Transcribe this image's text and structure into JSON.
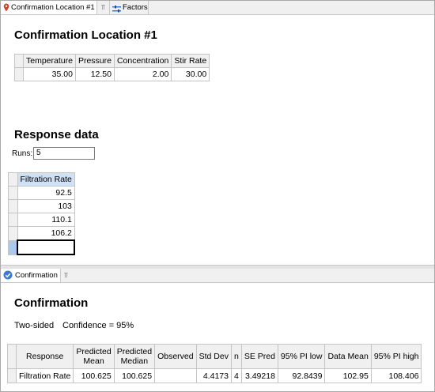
{
  "tabs_top": {
    "tab1": {
      "label": "Confirmation Location #1",
      "icon": "location-pin-icon"
    },
    "pin_glyph": "⫪",
    "tab2": {
      "label": "Factors",
      "icon": "factors-icon"
    }
  },
  "location": {
    "title": "Confirmation Location #1",
    "factor_headers": [
      "Temperature",
      "Pressure",
      "Concentration",
      "Stir Rate"
    ],
    "factor_values": [
      "35.00",
      "12.50",
      "2.00",
      "30.00"
    ]
  },
  "response": {
    "title": "Response data",
    "runs_label": "Runs:",
    "runs_value": "5",
    "column_header": "Filtration Rate",
    "values": [
      "92.5",
      "103",
      "110.1",
      "106.2",
      ""
    ]
  },
  "tabs_bottom": {
    "tab1": {
      "label": "Confirmation",
      "icon": "check-circle-icon"
    },
    "pin_glyph": "⫪"
  },
  "confirmation": {
    "title": "Confirmation",
    "sidedness": "Two-sided",
    "confidence": "Confidence = 95%",
    "headers": [
      "Response",
      "Predicted\nMean",
      "Predicted\nMedian",
      "Observed",
      "Std Dev",
      "n",
      "SE Pred",
      "95% PI low",
      "Data Mean",
      "95% PI high"
    ],
    "row": [
      "Filtration Rate",
      "100.625",
      "100.625",
      "",
      "4.4173",
      "4",
      "3.49218",
      "92.8439",
      "102.95",
      "108.406"
    ]
  },
  "colors": {
    "accent": "#3a7bd5",
    "selected_header": "#cfe1f5",
    "selected_row": "#a9c9ee"
  }
}
